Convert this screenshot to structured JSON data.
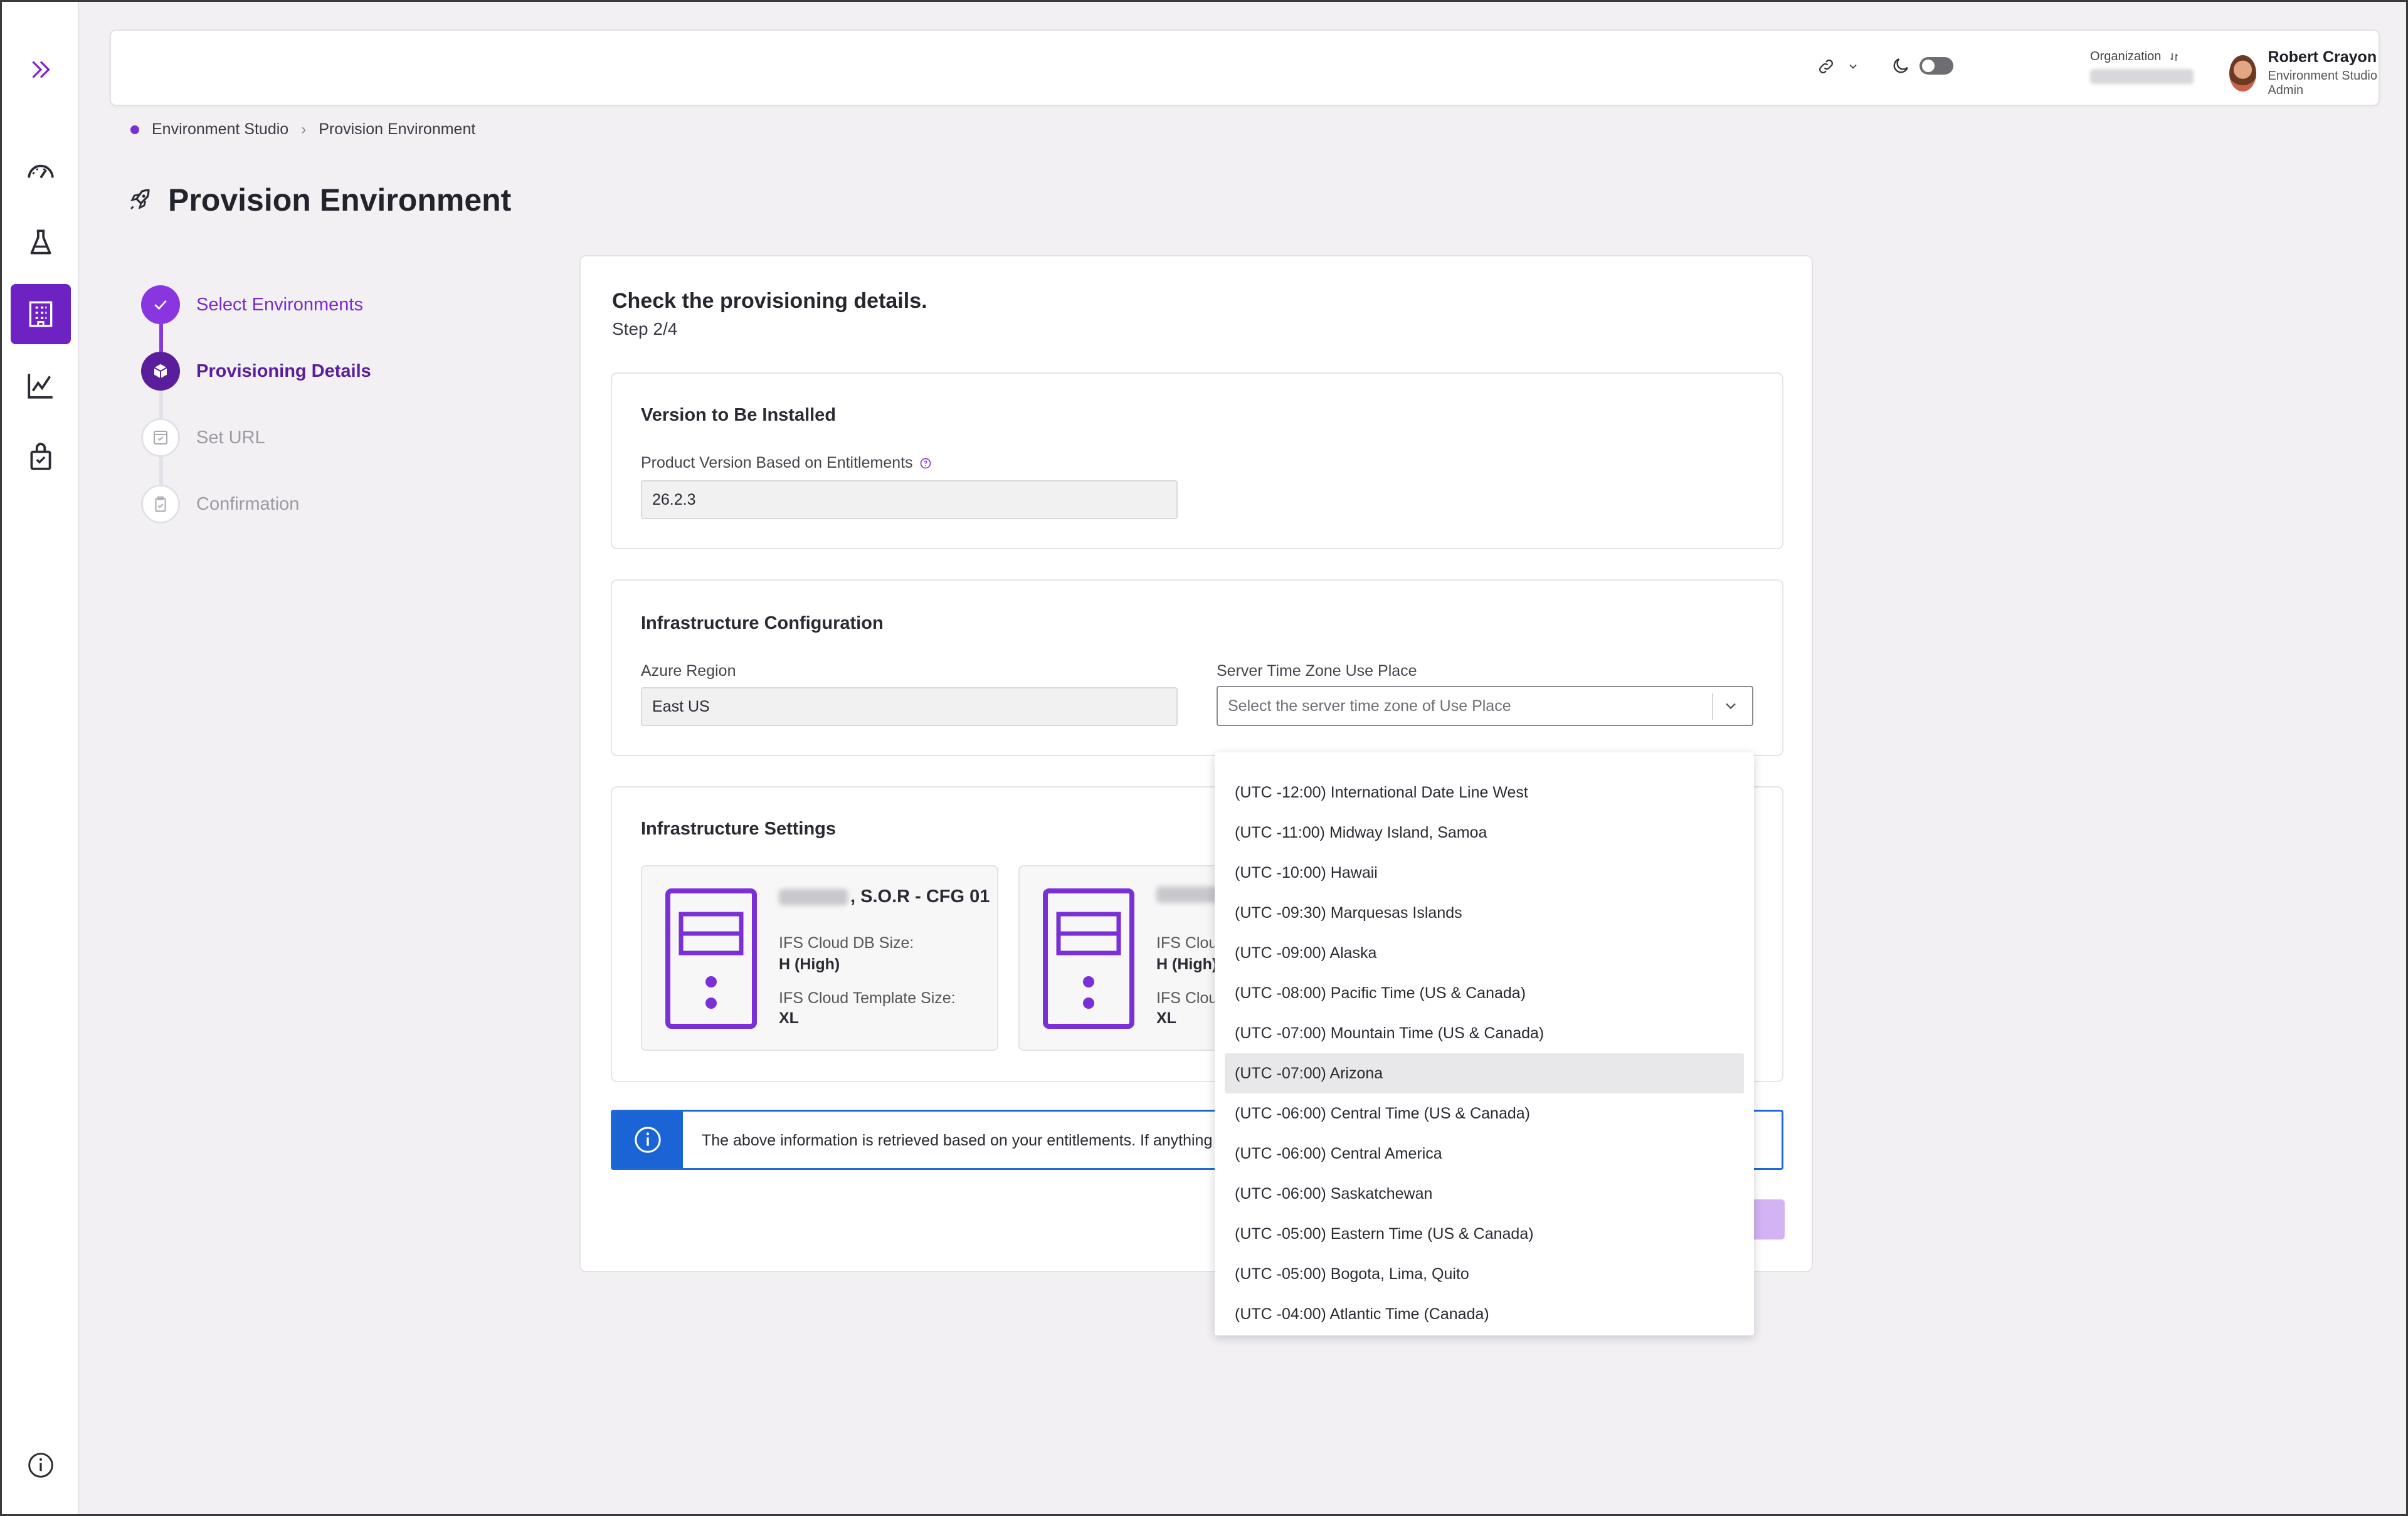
{
  "header": {
    "org_label": "Organization",
    "user_name": "Robert Crayon",
    "user_role": "Environment Studio Admin"
  },
  "breadcrumb": {
    "items": [
      "Environment Studio",
      "Provision Environment"
    ]
  },
  "page": {
    "title": "Provision Environment"
  },
  "stepper": {
    "steps": [
      {
        "label": "Select Environments",
        "state": "done"
      },
      {
        "label": "Provisioning Details",
        "state": "current"
      },
      {
        "label": "Set URL",
        "state": "todo"
      },
      {
        "label": "Confirmation",
        "state": "todo"
      }
    ]
  },
  "card": {
    "heading": "Check the provisioning details.",
    "step_text": "Step 2/4"
  },
  "version": {
    "title": "Version to Be Installed",
    "field_label": "Product Version Based on Entitlements",
    "value": "26.2.3"
  },
  "infra_config": {
    "title": "Infrastructure Configuration",
    "region_label": "Azure Region",
    "region_value": "East US",
    "timezone_label": "Server Time Zone Use Place",
    "timezone_placeholder": "Select the server time zone of Use Place"
  },
  "infra_settings": {
    "title": "Infrastructure Settings",
    "cards": [
      {
        "name_suffix": ", S.O.R - CFG 01",
        "db_label": "IFS Cloud DB Size:",
        "db_value": "H (High)",
        "tpl_label": "IFS Cloud Template Size:",
        "tpl_value": "XL"
      },
      {
        "name_suffix": "",
        "db_label": "IFS Cloud",
        "db_value": "H (High)",
        "tpl_label": "IFS Cloud",
        "tpl_value": "XL"
      }
    ]
  },
  "info_banner": {
    "text": "The above information is retrieved based on your entitlements. If anything"
  },
  "timezone_options": [
    "(UTC -12:00) International Date Line West",
    "(UTC -11:00) Midway Island, Samoa",
    "(UTC -10:00) Hawaii",
    "(UTC -09:30) Marquesas Islands",
    "(UTC -09:00) Alaska",
    "(UTC -08:00) Pacific Time (US & Canada)",
    "(UTC -07:00) Mountain Time (US & Canada)",
    "(UTC -07:00) Arizona",
    "(UTC -06:00) Central Time (US & Canada)",
    "(UTC -06:00) Central America",
    "(UTC -06:00) Saskatchewan",
    "(UTC -05:00) Eastern Time (US & Canada)",
    "(UTC -05:00) Bogota, Lima, Quito",
    "(UTC -04:00) Atlantic Time (Canada)"
  ],
  "highlighted_option_index": 7,
  "colors": {
    "brand": "#6e22c3",
    "step_done": "#8a36e0",
    "step_current": "#5a1e9c",
    "info": "#1a64d6"
  },
  "icons": {
    "sidebar": [
      "double-chevron-right-icon",
      "speedometer-icon",
      "flask-icon",
      "building-grid-icon",
      "line-chart-icon",
      "badge-lock-icon"
    ],
    "bottom": "info-circle-icon"
  }
}
